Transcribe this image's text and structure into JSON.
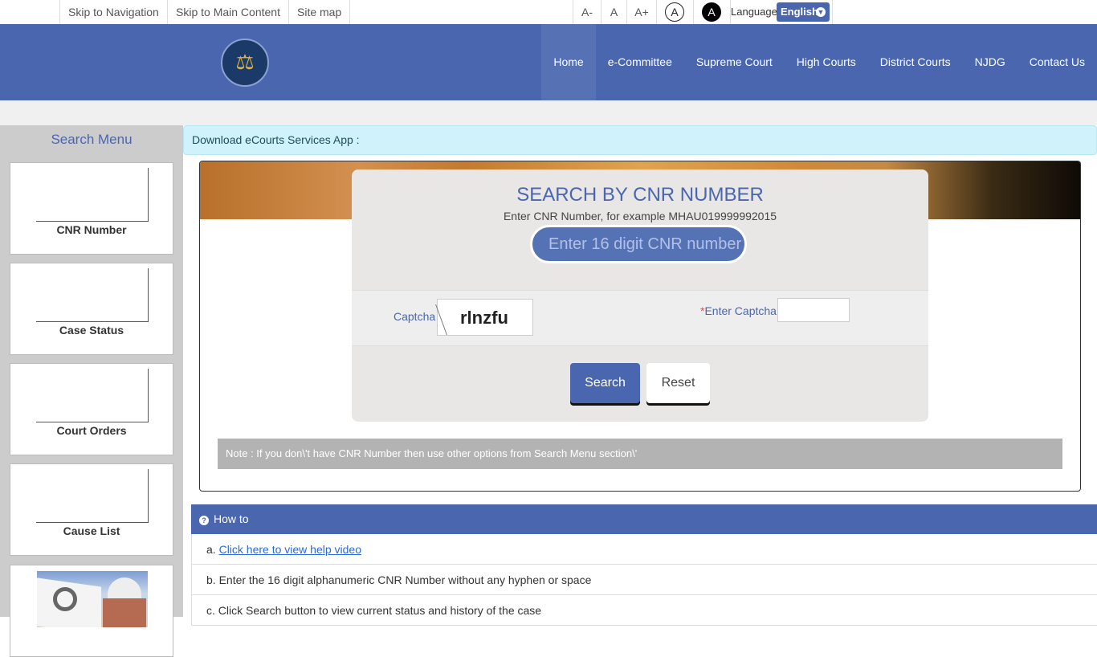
{
  "topbar": {
    "skip_links": [
      "Skip to Navigation",
      "Skip to Main Content",
      "Site map"
    ],
    "font_controls": [
      "A-",
      "A",
      "A+"
    ],
    "contrast_normal": "A",
    "contrast_dark": "A",
    "language_label": "Language",
    "language_value": "English",
    "language_icon": "download-circle-icon"
  },
  "header": {
    "logo_alt": "eCourts India emblem",
    "nav": [
      "Home",
      "e-Committee",
      "Supreme Court",
      "High Courts",
      "District Courts",
      "NJDG",
      "Contact Us"
    ],
    "active_nav": "Home",
    "brand_color": "#4a66ae"
  },
  "sidebar": {
    "title": "Search Menu",
    "items": [
      {
        "label": "CNR Number"
      },
      {
        "label": "Case Status"
      },
      {
        "label": "Court Orders"
      },
      {
        "label": "Cause List"
      },
      {
        "label": ""
      }
    ]
  },
  "main": {
    "download_text": "Download eCourts Services App :",
    "search": {
      "title": "SEARCH BY CNR NUMBER",
      "subtitle": "Enter CNR Number, for example MHAU019999992015",
      "cnr_placeholder": "Enter 16 digit CNR number",
      "cnr_value": "",
      "captcha_label": "Captcha",
      "captcha_text": "rlnzfu",
      "enter_captcha_required": "*",
      "enter_captcha_label": "Enter Captcha",
      "enter_captcha_value": "",
      "search_button": "Search",
      "reset_button": "Reset"
    },
    "note": "Note : If you don\\'t have CNR Number then use other options from Search Menu section\\'"
  },
  "howto": {
    "title": "How to",
    "rows": [
      {
        "prefix": "a. ",
        "link": "Click here to view help video"
      },
      {
        "text": "b. Enter the 16 digit alphanumeric CNR Number without any hyphen or space"
      },
      {
        "text": "c. Click Search button to view current status and history of the case"
      }
    ]
  }
}
